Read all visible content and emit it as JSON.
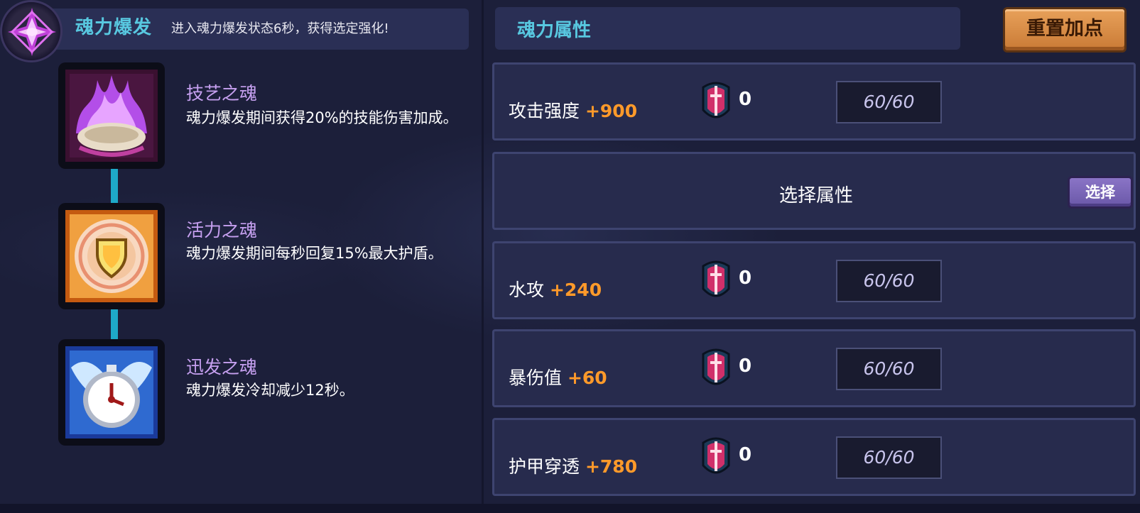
{
  "left_panel": {
    "title": "魂力爆发",
    "subtitle": "进入魂力爆发状态6秒，获得选定强化!",
    "talents": [
      {
        "name": "技艺之魂",
        "description": "魂力爆发期间获得20%的技能伤害加成。",
        "icon": "purple-flame-icon"
      },
      {
        "name": "活力之魂",
        "description": "魂力爆发期间每秒回复15%最大护盾。",
        "icon": "golden-shield-icon"
      },
      {
        "name": "迅发之魂",
        "description": "魂力爆发冷却减少12秒。",
        "icon": "winged-clock-icon"
      }
    ]
  },
  "right_panel": {
    "title": "魂力属性",
    "reset_label": "重置加点",
    "rows": [
      {
        "label": "攻击强度",
        "bonus": "+900",
        "gem_count": "0",
        "cap": "60/60"
      },
      {
        "label": "选择属性",
        "button": "选择"
      },
      {
        "label": "水攻",
        "bonus": "+240",
        "gem_count": "0",
        "cap": "60/60"
      },
      {
        "label": "暴伤值",
        "bonus": "+60",
        "gem_count": "0",
        "cap": "60/60"
      },
      {
        "label": "护甲穿透",
        "bonus": "+780",
        "gem_count": "0",
        "cap": "60/60"
      }
    ]
  },
  "colors": {
    "background": "#1c1f3a",
    "header_accent": "#58c8e0",
    "talent_name": "#c6a0f0",
    "bonus": "#ff9a2a",
    "reset_button": "#d98b45",
    "choose_button": "#7a66b8",
    "chain": "#1ea9c8"
  }
}
